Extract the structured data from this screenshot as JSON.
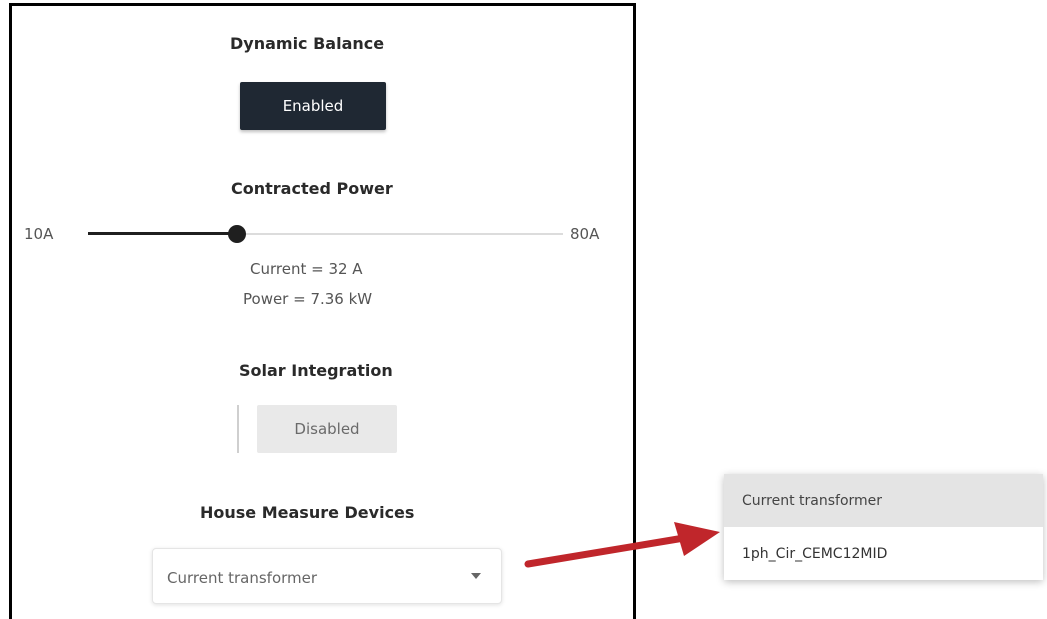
{
  "dynamic_balance": {
    "title": "Dynamic Balance",
    "button_label": "Enabled"
  },
  "contracted_power": {
    "title": "Contracted Power",
    "min_label": "10A",
    "max_label": "80A",
    "min_value": 10,
    "max_value": 80,
    "current_value": 32,
    "current_text": "Current = 32 A",
    "power_text": "Power = 7.36 kW"
  },
  "solar_integration": {
    "title": "Solar Integration",
    "button_label": "Disabled"
  },
  "house_measure_devices": {
    "title": "House Measure Devices",
    "selected_value": "Current transformer",
    "options": [
      "Current transformer",
      "1ph_Cir_CEMC12MID"
    ]
  },
  "colors": {
    "dark_button": "#1f2833",
    "annotation_arrow": "#c0262b"
  }
}
